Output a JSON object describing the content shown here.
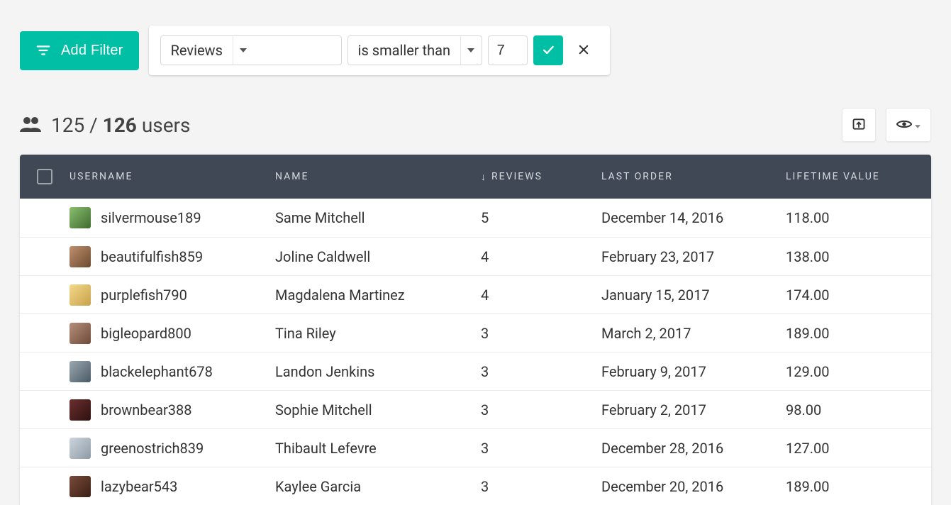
{
  "accent_color": "#00bfa5",
  "toolbar": {
    "add_filter_label": "Add Filter"
  },
  "filter": {
    "field": "Reviews",
    "operator": "is smaller than",
    "value": "7"
  },
  "count": {
    "current": "125",
    "separator": " / ",
    "total": "126",
    "noun": " users"
  },
  "columns": {
    "username": "USERNAME",
    "name": "NAME",
    "reviews": "REVIEWS",
    "last_order": "LAST ORDER",
    "lifetime_value": "LIFETIME VALUE",
    "sort_indicator": "↓"
  },
  "rows": [
    {
      "username": "silvermouse189",
      "name": "Same Mitchell",
      "reviews": "5",
      "last_order": "December 14, 2016",
      "lifetime_value": "118.00"
    },
    {
      "username": "beautifulfish859",
      "name": "Joline Caldwell",
      "reviews": "4",
      "last_order": "February 23, 2017",
      "lifetime_value": "138.00"
    },
    {
      "username": "purplefish790",
      "name": "Magdalena Martinez",
      "reviews": "4",
      "last_order": "January 15, 2017",
      "lifetime_value": "174.00"
    },
    {
      "username": "bigleopard800",
      "name": "Tina Riley",
      "reviews": "3",
      "last_order": "March 2, 2017",
      "lifetime_value": "189.00"
    },
    {
      "username": "blackelephant678",
      "name": "Landon Jenkins",
      "reviews": "3",
      "last_order": "February 9, 2017",
      "lifetime_value": "129.00"
    },
    {
      "username": "brownbear388",
      "name": "Sophie Mitchell",
      "reviews": "3",
      "last_order": "February 2, 2017",
      "lifetime_value": "98.00"
    },
    {
      "username": "greenostrich839",
      "name": "Thibault Lefevre",
      "reviews": "3",
      "last_order": "December 28, 2016",
      "lifetime_value": "127.00"
    },
    {
      "username": "lazybear543",
      "name": "Kaylee Garcia",
      "reviews": "3",
      "last_order": "December 20, 2016",
      "lifetime_value": "189.00"
    }
  ]
}
